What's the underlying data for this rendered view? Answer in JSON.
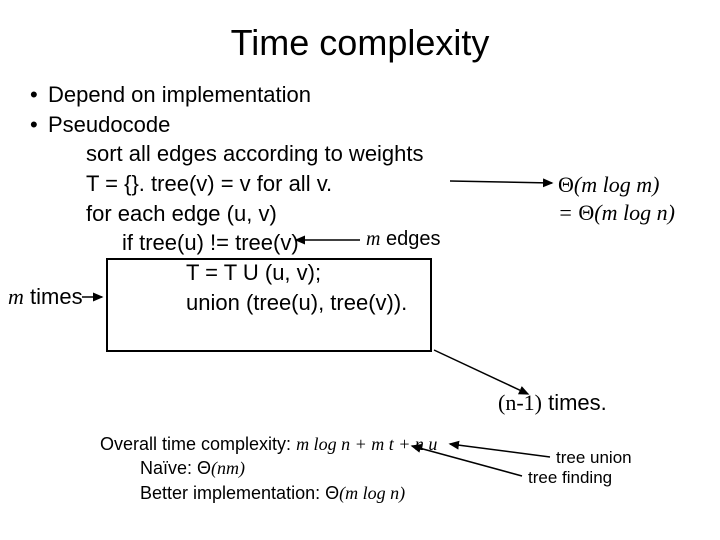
{
  "title": "Time complexity",
  "bullets": {
    "b1": "Depend on implementation",
    "b2": "Pseudocode"
  },
  "code": {
    "l1": "sort all edges according to weights",
    "l2": "T = {}. tree(v) = v for all v.",
    "l3_prefix": "for each edge (u, v)",
    "l3_ann": "m edges",
    "l4": "if tree(u) != tree(v)",
    "l5": "T = T U (u, v);",
    "l6": "union (tree(u), tree(v)).",
    "m_edges_m": "m",
    "m_edges_word": " edges"
  },
  "ann": {
    "mlogm_theta": "Θ",
    "mlogm_expr": "(m log m)",
    "eq": "= ",
    "mlogn_theta": "Θ",
    "mlogn_expr": "(m log n)",
    "m_times_m": "m",
    "m_times_word": " times",
    "n1_paren": "(n-1)",
    "n1_word": " times.",
    "tree_union": "tree union",
    "tree_finding": "tree finding"
  },
  "overall": {
    "label": "Overall time complexity: ",
    "expr": "m log n + m t + n u",
    "naive_label": "Naïve: ",
    "naive_theta": "Θ",
    "naive_expr": "(nm)",
    "better_label": "Better implementation: ",
    "better_theta": "Θ",
    "better_expr": "(m log n)"
  }
}
